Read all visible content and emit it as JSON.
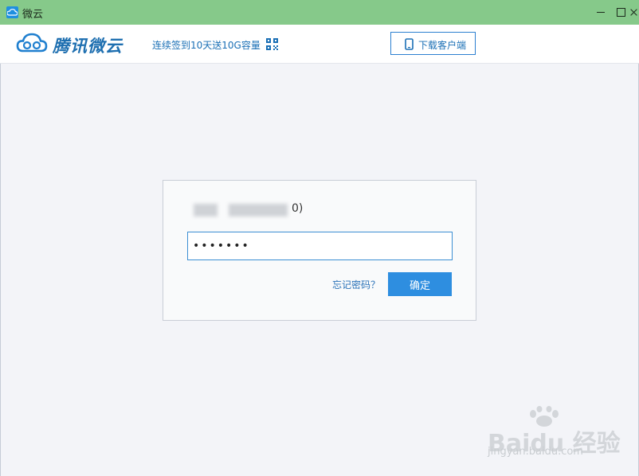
{
  "window": {
    "title": "微云",
    "minimize": "minimize-icon",
    "maximize": "maximize-icon",
    "close": "close-icon"
  },
  "header": {
    "brand": "腾讯微云",
    "promo": "连续签到10天送10G容量",
    "qr_icon": "qr-code-icon",
    "download_label": "下载客户端"
  },
  "login": {
    "account_suffix": "0)",
    "password_value": "•••••••",
    "forgot_link": "忘记密码？",
    "confirm_label": "确定"
  },
  "watermark": {
    "brand": "Baidu 经验",
    "url": "jingyan.baidu.com"
  },
  "colors": {
    "titlebar": "#86c98a",
    "accent": "#2e8ee0",
    "link": "#1a6fb5",
    "background": "#f3f4f8"
  }
}
